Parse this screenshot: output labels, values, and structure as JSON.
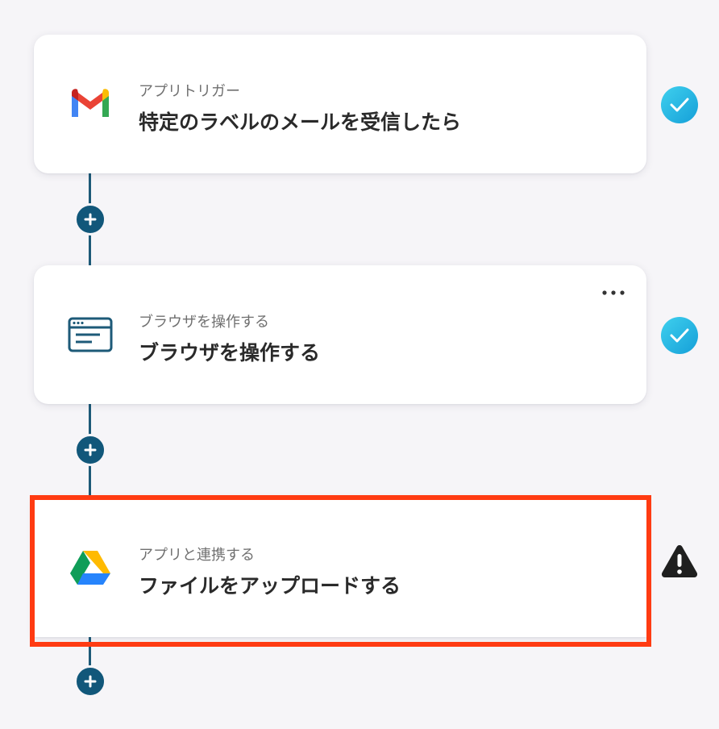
{
  "flow": {
    "steps": [
      {
        "subtitle": "アプリトリガー",
        "title": "特定のラベルのメールを受信したら",
        "icon": "gmail-icon",
        "status": "completed"
      },
      {
        "subtitle": "ブラウザを操作する",
        "title": "ブラウザを操作する",
        "icon": "browser-icon",
        "status": "completed",
        "has_more_menu": true
      },
      {
        "subtitle": "アプリと連携する",
        "title": "ファイルをアップロードする",
        "icon": "google-drive-icon",
        "status": "warning",
        "highlighted": true
      }
    ],
    "add_step_icon": "plus-icon"
  },
  "colors": {
    "connector": "#1d5a78",
    "add_button": "#11577a",
    "check_gradient_start": "#2dc6e8",
    "check_gradient_end": "#1aa6d9",
    "warning": "#1f1f1f",
    "highlight_border": "#ff3b12"
  }
}
